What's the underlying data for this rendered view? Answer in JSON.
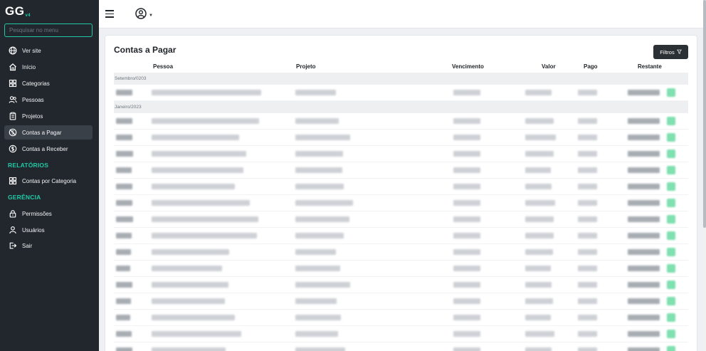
{
  "sidebar": {
    "brand": "GG",
    "brand_version": "v4",
    "search_placeholder": "Pesquisar no menu",
    "items": [
      {
        "label": "Ver site",
        "icon": "globe-icon"
      },
      {
        "label": "Início",
        "icon": "home-icon"
      },
      {
        "label": "Categorias",
        "icon": "grid-icon"
      },
      {
        "label": "Pessoas",
        "icon": "people-icon"
      },
      {
        "label": "Projetos",
        "icon": "clipboard-icon"
      },
      {
        "label": "Contas a Pagar",
        "icon": "no-money-icon",
        "active": true
      },
      {
        "label": "Contas a Receber",
        "icon": "dollar-circle-icon"
      }
    ],
    "section_reports": "RELATÓRIOS",
    "report_items": [
      {
        "label": "Contas por Categoria",
        "icon": "grid-icon"
      }
    ],
    "section_management": "GERÊNCIA",
    "management_items": [
      {
        "label": "Permissões",
        "icon": "lock-icon"
      },
      {
        "label": "Usuários",
        "icon": "user-icon"
      },
      {
        "label": "Sair",
        "icon": "logout-icon"
      }
    ]
  },
  "topbar": {
    "menu_icon": "hamburger-icon",
    "user_icon": "user-circle-icon",
    "caret_icon": "chevron-down-icon"
  },
  "main": {
    "title": "Contas a Pagar",
    "filter_button": "Filtros",
    "columns": [
      "Pessoa",
      "Projeto",
      "Vencimento",
      "Valor",
      "Pago",
      "Restante"
    ],
    "groups": [
      {
        "label": "Setembro/0203",
        "row_count": 1
      },
      {
        "label": "Janeiro/2023",
        "row_count": 15
      }
    ]
  },
  "colors": {
    "sidebar_bg": "#22272d",
    "accent": "#20c9a6",
    "active_item_bg": "#3a4048",
    "button_dark": "#2b3035",
    "action_green": "#7fe0b0"
  }
}
